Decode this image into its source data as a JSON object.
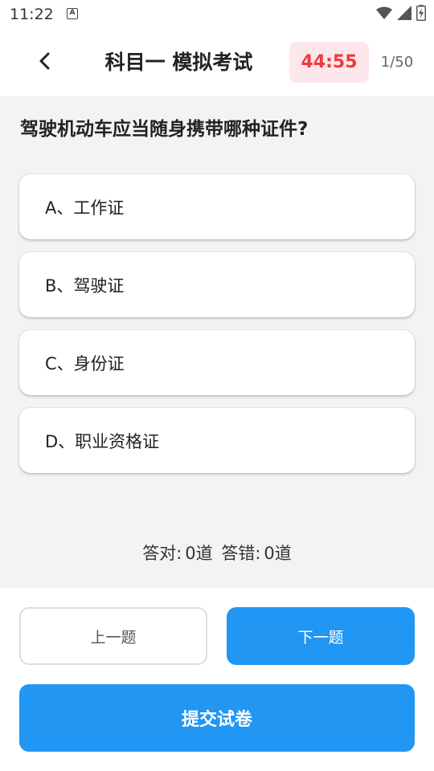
{
  "status_bar": {
    "time": "11:22",
    "notification_icon": "A"
  },
  "header": {
    "title": "科目一 模拟考试",
    "timer": "44:55",
    "progress": "1/50"
  },
  "question": {
    "text": "驾驶机动车应当随身携带哪种证件?",
    "options": [
      {
        "label": "A、工作证"
      },
      {
        "label": "B、驾驶证"
      },
      {
        "label": "C、身份证"
      },
      {
        "label": "D、职业资格证"
      }
    ]
  },
  "score": {
    "correct_label": "答对:",
    "correct_value": "0道",
    "wrong_label": "答错:",
    "wrong_value": "0道"
  },
  "buttons": {
    "prev": "上一题",
    "next": "下一题",
    "submit": "提交试卷"
  },
  "colors": {
    "accent": "#2196f3",
    "timer_text": "#ee3b3b",
    "timer_bg": "#fde7ea",
    "main_bg": "#f3f3f3"
  },
  "icons": {
    "back": "chevron-left-icon",
    "wifi": "wifi-icon",
    "signal": "signal-icon",
    "battery": "battery-charging-icon"
  }
}
